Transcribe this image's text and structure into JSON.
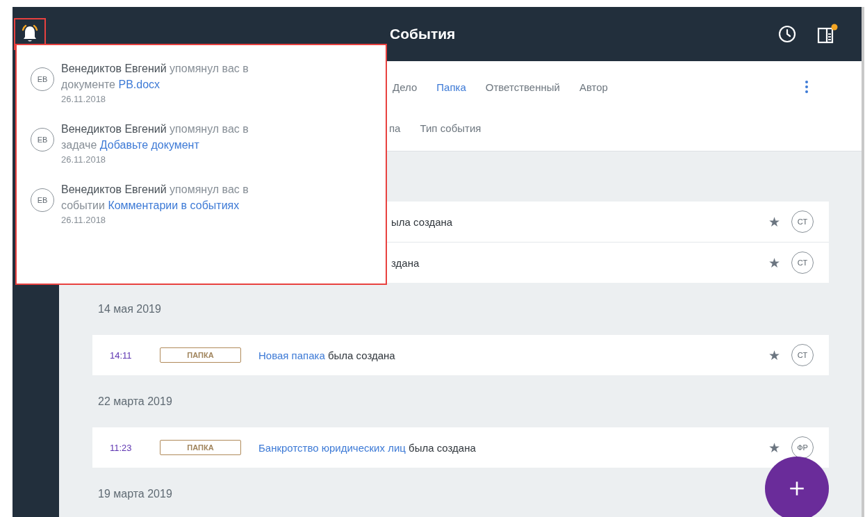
{
  "header": {
    "title": "События",
    "notification_highlighted": true,
    "panel_badge": true
  },
  "filters": {
    "row_1": [
      {
        "label": "Дело",
        "selected": false
      },
      {
        "label": "Папка",
        "selected": true
      },
      {
        "label": "Ответственный",
        "selected": false
      },
      {
        "label": "Автор",
        "selected": false
      }
    ],
    "row_2": [
      {
        "label": "па",
        "selected": false
      },
      {
        "label": "Тип события",
        "selected": false
      }
    ]
  },
  "feed": [
    {
      "kind": "card",
      "rows": [
        {
          "text": "ыла создана",
          "star": "★",
          "author": "СТ"
        },
        {
          "text": "здана",
          "star": "★",
          "author": "СТ"
        }
      ]
    },
    {
      "kind": "date",
      "label": "14 мая 2019"
    },
    {
      "kind": "card",
      "rows": [
        {
          "time": "14:11",
          "tag": "ПАПКА",
          "link": "Новая папака",
          "text": "была создана",
          "star": "★",
          "author": "СТ"
        }
      ]
    },
    {
      "kind": "date",
      "label": "22 марта 2019"
    },
    {
      "kind": "card",
      "rows": [
        {
          "time": "11:23",
          "tag": "ПАПКА",
          "link": "Банкротство юридических лиц",
          "text": "была создана",
          "star": "★",
          "author": "ФР"
        }
      ]
    },
    {
      "kind": "date",
      "label": "19 марта 2019"
    }
  ],
  "notifications": [
    {
      "initials": "ЕВ",
      "author": "Венедиктов Евгений",
      "action": "упомянул вас в документе",
      "link": "PB.docx",
      "date": "26.11.2018"
    },
    {
      "initials": "ЕВ",
      "author": "Венедиктов Евгений",
      "action": "упомянул вас в задаче",
      "link": "Добавьте документ",
      "date": "26.11.2018"
    },
    {
      "initials": "ЕВ",
      "author": "Венедиктов Евгений",
      "action": "упомянул вас в событии",
      "link": "Комментарии в событиях",
      "date": "26.11.2018"
    }
  ]
}
